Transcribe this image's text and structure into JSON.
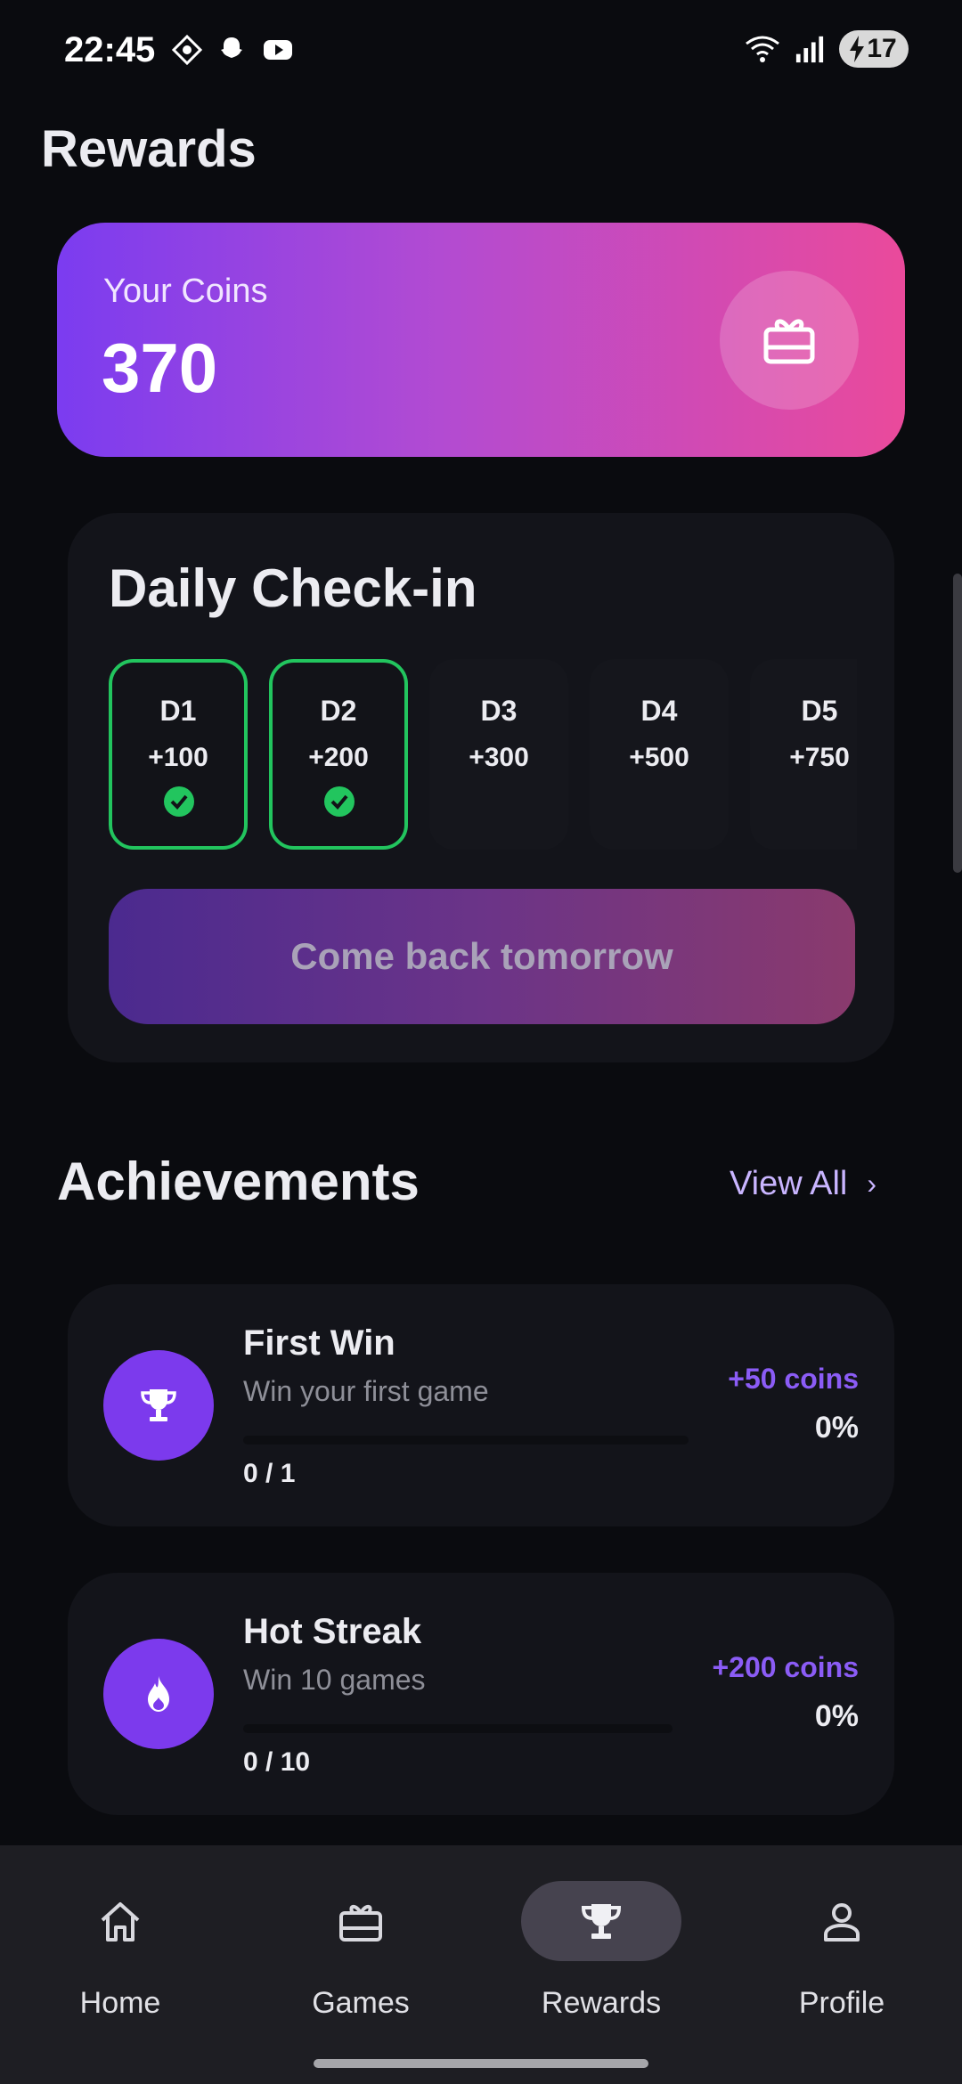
{
  "status": {
    "time": "22:45",
    "battery": "17",
    "icons": [
      "app-icon",
      "snapchat-icon",
      "youtube-icon",
      "wifi-icon",
      "signal-icon",
      "battery-icon"
    ]
  },
  "page": {
    "title": "Rewards"
  },
  "coins": {
    "label": "Your Coins",
    "value": "370",
    "icon": "gift-card-icon"
  },
  "checkin": {
    "title": "Daily Check-in",
    "days": [
      {
        "label": "D1",
        "reward": "+100",
        "claimed": true
      },
      {
        "label": "D2",
        "reward": "+200",
        "claimed": true
      },
      {
        "label": "D3",
        "reward": "+300",
        "claimed": false
      },
      {
        "label": "D4",
        "reward": "+500",
        "claimed": false
      },
      {
        "label": "D5",
        "reward": "+750",
        "claimed": false
      }
    ],
    "button_label": "Come back tomorrow"
  },
  "achievements": {
    "title": "Achievements",
    "view_all": "View All",
    "view_all_chevron": "›",
    "items": [
      {
        "name": "First Win",
        "description": "Win your first game",
        "reward": "+50 coins",
        "percent": "0%",
        "count": "0 / 1",
        "progress": 0,
        "icon": "trophy-icon"
      },
      {
        "name": "Hot Streak",
        "description": "Win 10 games",
        "reward": "+200 coins",
        "percent": "0%",
        "count": "0 / 10",
        "progress": 0,
        "icon": "flame-icon"
      }
    ]
  },
  "nav": {
    "items": [
      {
        "label": "Home",
        "icon": "home-icon",
        "active": false
      },
      {
        "label": "Games",
        "icon": "gift-card-icon",
        "active": false
      },
      {
        "label": "Rewards",
        "icon": "trophy-icon",
        "active": true
      },
      {
        "label": "Profile",
        "icon": "person-icon",
        "active": false
      }
    ]
  },
  "colors": {
    "background": "#0a0b0f",
    "card": "#13141a",
    "accent": "#7c3aed",
    "success": "#22c55e",
    "coins_gradient_start": "#7b3cf0",
    "coins_gradient_end": "#ea4a9b"
  }
}
